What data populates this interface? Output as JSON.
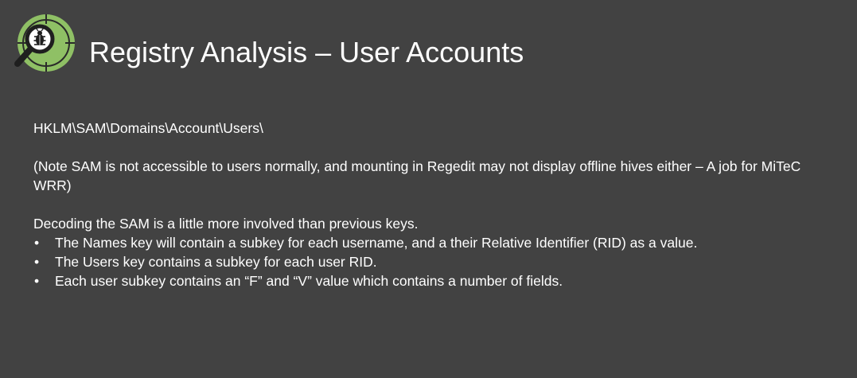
{
  "slide": {
    "title": "Registry Analysis – User Accounts",
    "logo_icon": "magnifier-bug-icon",
    "registry_path": "HKLM\\SAM\\Domains\\Account\\Users\\",
    "note": "(Note SAM is not accessible to users normally, and mounting in Regedit may not display offline hives either – A job for MiTeC WRR)",
    "intro": "Decoding the SAM is a little more involved than previous keys.",
    "bullets": [
      "The Names key will contain a subkey for each username, and a their Relative Identifier (RID) as a value.",
      "The Users key contains a subkey for each user RID.",
      "Each user subkey contains an “F” and “V” value which contains a number of fields."
    ],
    "bullet_glyph": "•"
  },
  "colors": {
    "background": "#424242",
    "text": "#ffffff",
    "logo_green": "#8fc065",
    "logo_dark": "#1f1f1f"
  }
}
